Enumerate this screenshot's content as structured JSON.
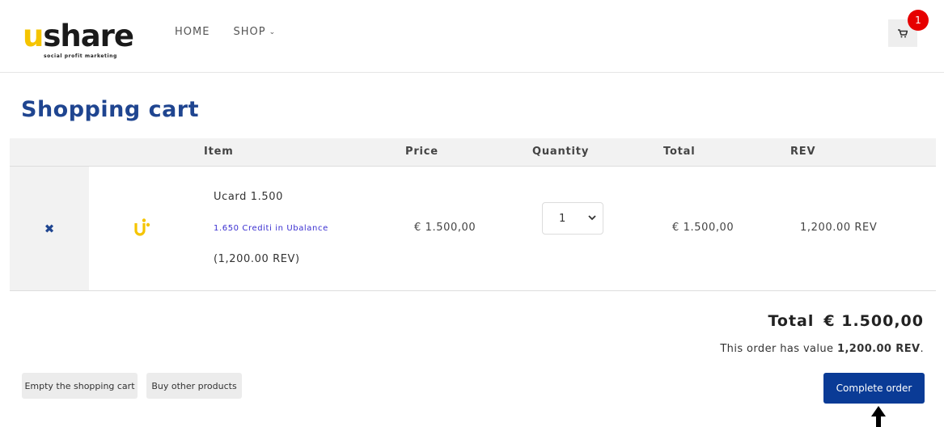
{
  "header": {
    "logo_text": "ushare",
    "logo_tagline": "social profit marketing",
    "nav": [
      {
        "label": "HOME"
      },
      {
        "label": "SHOP",
        "chevron": "chevron-down-icon"
      }
    ],
    "cart_icon": "cart-icon",
    "cart_count": "1"
  },
  "page": {
    "title": "Shopping cart"
  },
  "table": {
    "headers": {
      "item": "Item",
      "price": "Price",
      "quantity": "Quantity",
      "total": "Total",
      "rev": "REV"
    },
    "rows": [
      {
        "remove_icon": "close-icon",
        "name": "Ucard 1.500",
        "subtitle": "1.650 Crediti in Ubalance",
        "rev_note": "(1,200.00 REV)",
        "price": "€ 1.500,00",
        "quantity": "1",
        "total": "€ 1.500,00",
        "rev": "1,200.00 REV"
      }
    ]
  },
  "summary": {
    "total_label": "Total",
    "total_value": "€ 1.500,00",
    "value_prefix": "This order has value",
    "value_amount": "1,200.00 REV",
    "value_suffix": "."
  },
  "actions": {
    "empty_cart": "Empty the shopping cart",
    "buy_other": "Buy other products",
    "complete_order": "Complete order"
  },
  "colors": {
    "brand_blue": "#1f4590",
    "button_blue": "#0a3b96",
    "brand_yellow": "#f5c400",
    "badge_red": "#e60000"
  }
}
